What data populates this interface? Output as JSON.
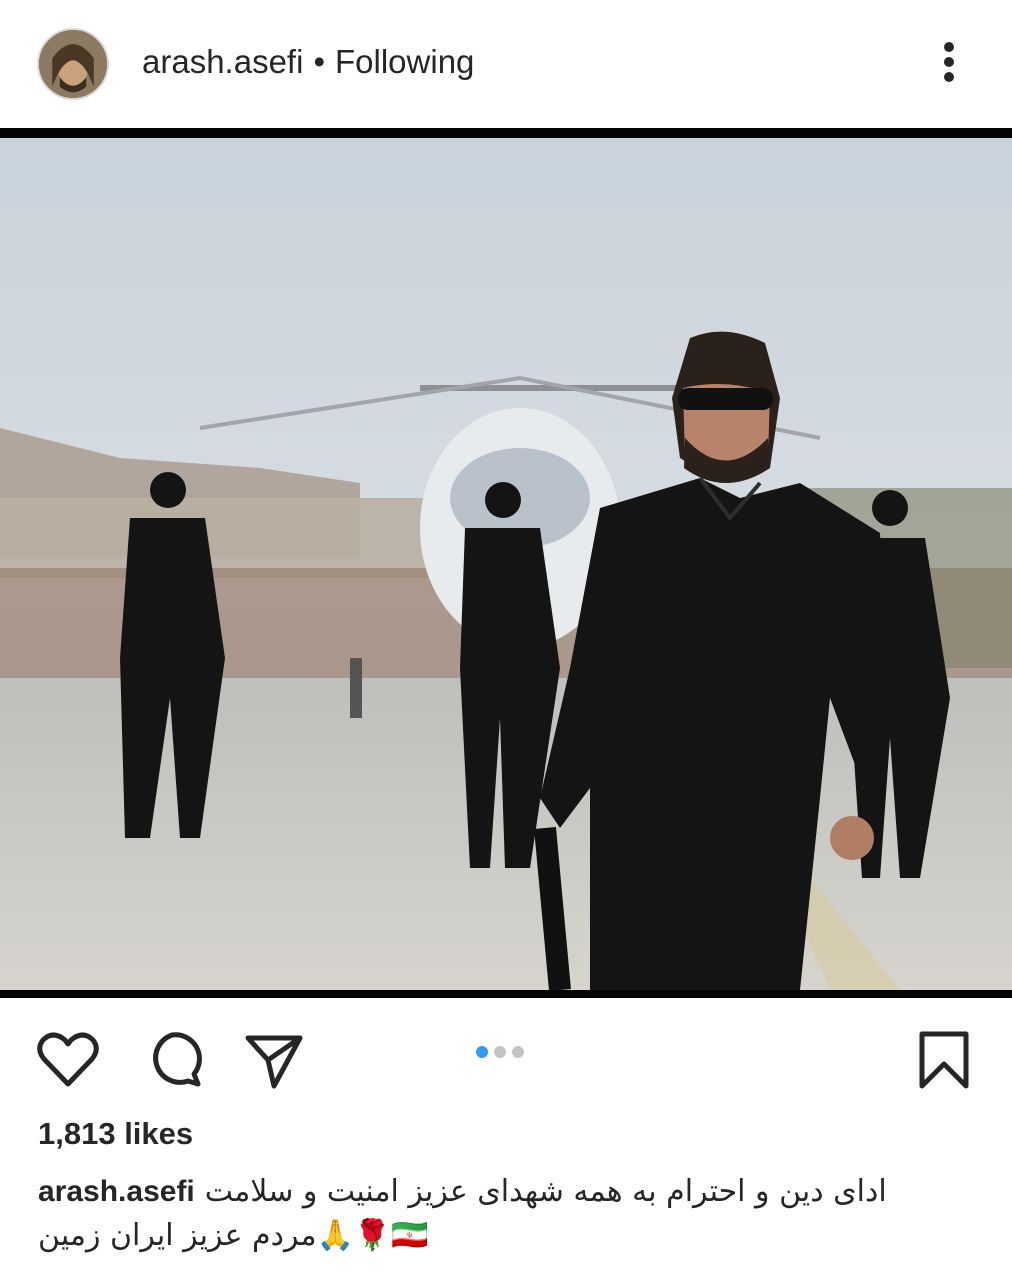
{
  "post": {
    "username": "arash.asefi",
    "separator": "•",
    "follow_status": "Following",
    "likes": "1,813 likes",
    "caption_line1": "ادای دین و احترام به همه شهدای عزیز امنیت و سلامت",
    "caption_line2": "🇮🇷🌹🙏مردم  عزیز ایران زمین",
    "carousel": {
      "count": 3,
      "active_index": 0
    }
  },
  "icons": {
    "like": "heart-outline-icon",
    "comment": "comment-bubble-icon",
    "share": "paper-plane-icon",
    "save": "bookmark-icon",
    "more": "vertical-ellipsis-icon"
  },
  "colors": {
    "text": "#262626",
    "carousel_active": "#3897f0",
    "carousel_inactive": "#c4c4c4"
  }
}
